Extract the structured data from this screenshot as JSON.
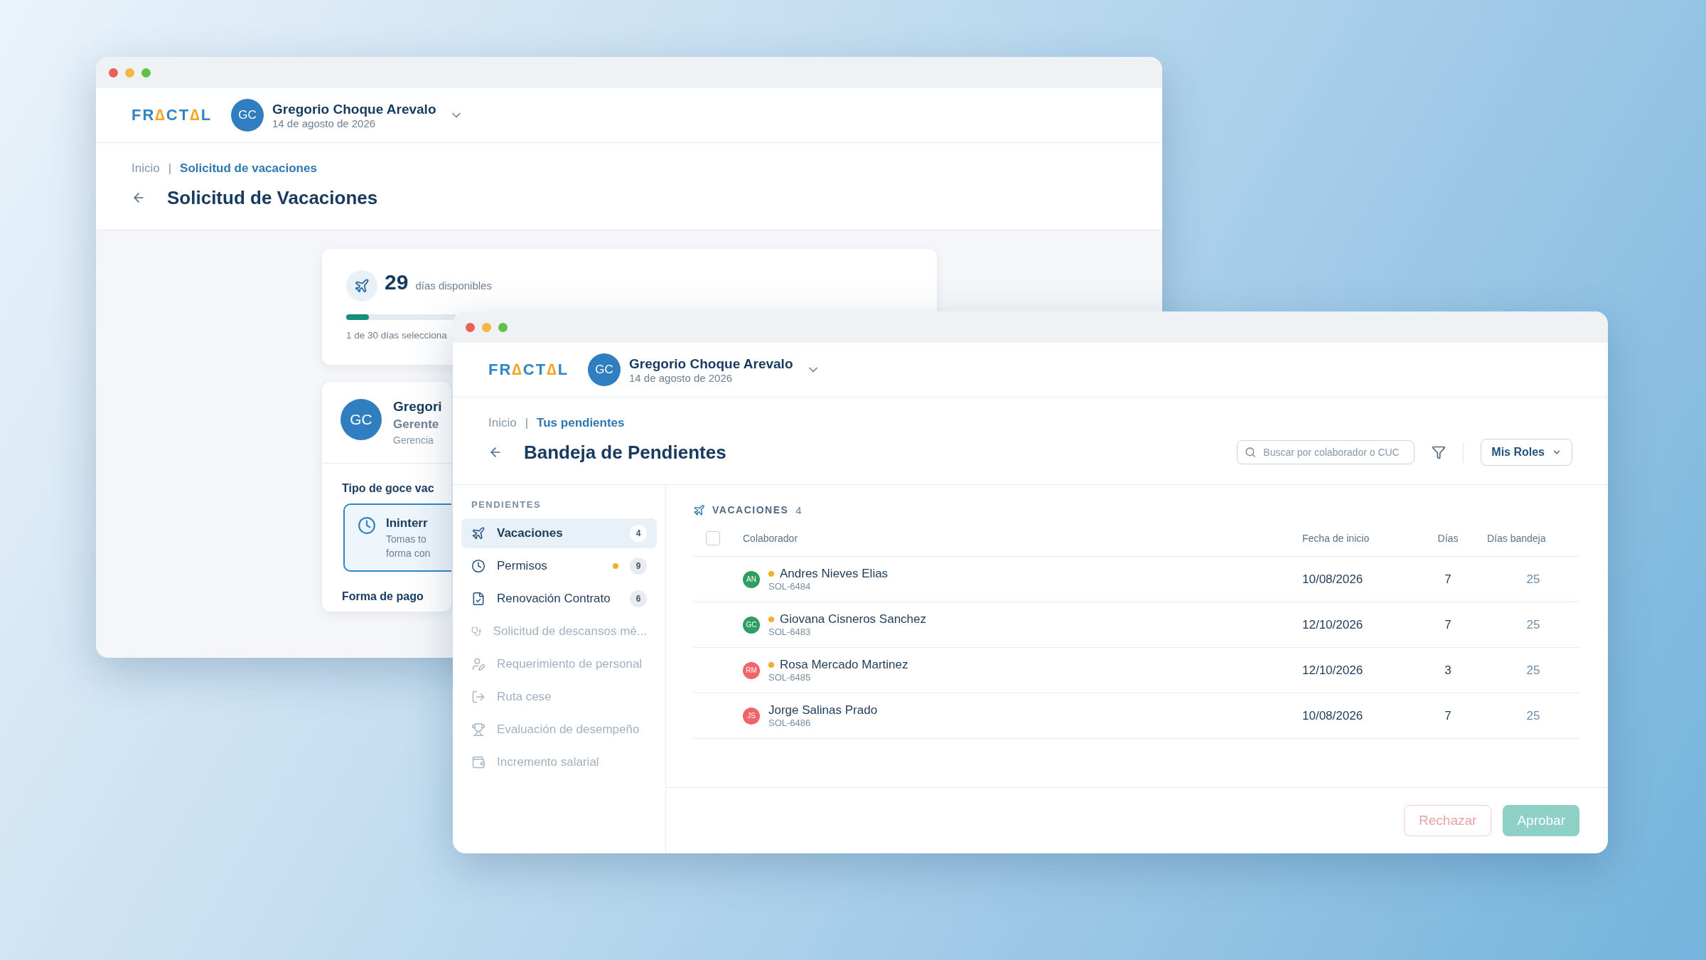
{
  "back_window": {
    "logo": "FR∆CT∆L",
    "user": {
      "initials": "GC",
      "name": "Gregorio Choque Arevalo",
      "date": "14 de agosto de 2026"
    },
    "breadcrumb": {
      "home": "Inicio",
      "separator": "|",
      "current": "Solicitud de vacaciones"
    },
    "title": "Solicitud de Vacaciones",
    "balance": {
      "count": "29",
      "label": "días disponibles",
      "level": 0.04,
      "caption": "1 de 30 días selecciona"
    },
    "profile": {
      "initials": "GC",
      "name": "Gregori",
      "role": "Gerente",
      "area": "Gerencia"
    },
    "leave_type": {
      "heading": "Tipo de goce vac",
      "option_title": "Ininterr",
      "option_text": [
        "Tomas to",
        "forma con"
      ],
      "selected": true
    },
    "payment": {
      "heading": "Forma de pago"
    }
  },
  "front_window": {
    "logo": "FR∆CT∆L",
    "user": {
      "initials": "GC",
      "name": "Gregorio Choque Arevalo",
      "date": "14 de agosto de 2026"
    },
    "breadcrumb": {
      "home": "Inicio",
      "separator": "|",
      "current": "Tus pendientes"
    },
    "title": "Bandeja de Pendientes",
    "search": {
      "placeholder": "Buscar por colaborador o CUC"
    },
    "roles_button": "Mis Roles",
    "sidebar": {
      "heading": "PENDIENTES",
      "items": [
        {
          "label": "Vacaciones",
          "count": "4",
          "selected": true,
          "disabled": false,
          "flagged": false
        },
        {
          "label": "Permisos",
          "count": "9",
          "selected": false,
          "disabled": false,
          "flagged": true
        },
        {
          "label": "Renovación Contrato",
          "count": "6",
          "selected": false,
          "disabled": false,
          "flagged": false
        },
        {
          "label": "Solicitud de descansos mé...",
          "selected": false,
          "disabled": true,
          "flagged": false
        },
        {
          "label": "Requerimiento de personal",
          "selected": false,
          "disabled": true,
          "flagged": false
        },
        {
          "label": "Ruta cese",
          "selected": false,
          "disabled": true,
          "flagged": false
        },
        {
          "label": "Evaluación de desempeño",
          "selected": false,
          "disabled": true,
          "flagged": false
        },
        {
          "label": "Incremento salarial",
          "selected": false,
          "disabled": true,
          "flagged": false
        }
      ]
    },
    "section": {
      "title": "VACACIONES",
      "count": "4"
    },
    "table": {
      "select_all": {
        "checked": false
      },
      "columns": [
        "Colaborador",
        "Fecha de inicio",
        "Días",
        "Días bandeja"
      ],
      "rows": [
        {
          "initials": "AN",
          "color": "#2e9e62",
          "flagged": true,
          "name": "Andres Nieves Elias",
          "code": "SOL-6484",
          "start": "10/08/2026",
          "days": "7",
          "tray_days": "25"
        },
        {
          "initials": "GC",
          "color": "#2e9e62",
          "flagged": true,
          "name": "Giovana Cisneros Sanchez",
          "code": "SOL-6483",
          "start": "12/10/2026",
          "days": "7",
          "tray_days": "25"
        },
        {
          "initials": "RM",
          "color": "#f0646a",
          "flagged": true,
          "name": "Rosa Mercado Martinez",
          "code": "SOL-6485",
          "start": "12/10/2026",
          "days": "3",
          "tray_days": "25"
        },
        {
          "initials": "JS",
          "color": "#f0646a",
          "flagged": false,
          "name": "Jorge Salinas Prado",
          "code": "SOL-6486",
          "start": "10/08/2026",
          "days": "7",
          "tray_days": "25"
        }
      ]
    },
    "actions": [
      {
        "label": "Rechazar",
        "kind": "reject",
        "disabled": true
      },
      {
        "label": "Aprobar",
        "kind": "approve",
        "disabled": true
      }
    ]
  }
}
